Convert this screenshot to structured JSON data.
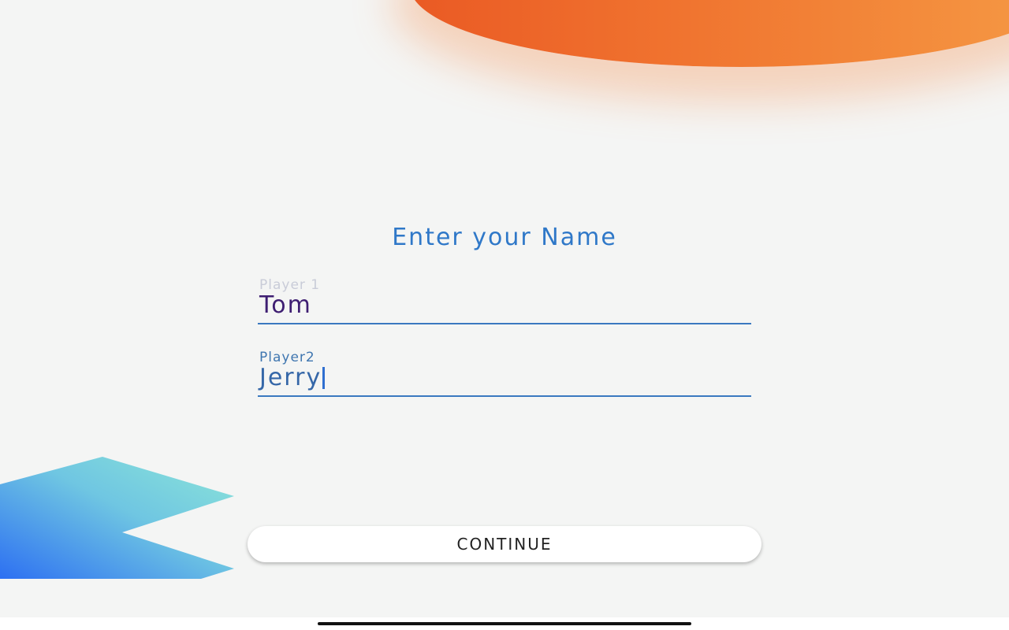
{
  "title": "Enter your Name",
  "fields": [
    {
      "label": "Player 1",
      "value": "Tom",
      "focused": false
    },
    {
      "label": "Player2",
      "value": "Jerry",
      "focused": true
    }
  ],
  "continue_label": "CONTINUE",
  "colors": {
    "background": "#f4f5f4",
    "accent_blue": "#2f78c8",
    "orange_blob": "#f0732f",
    "teal_shape": "#86e0d6",
    "blue_shape": "#2f72f2"
  }
}
